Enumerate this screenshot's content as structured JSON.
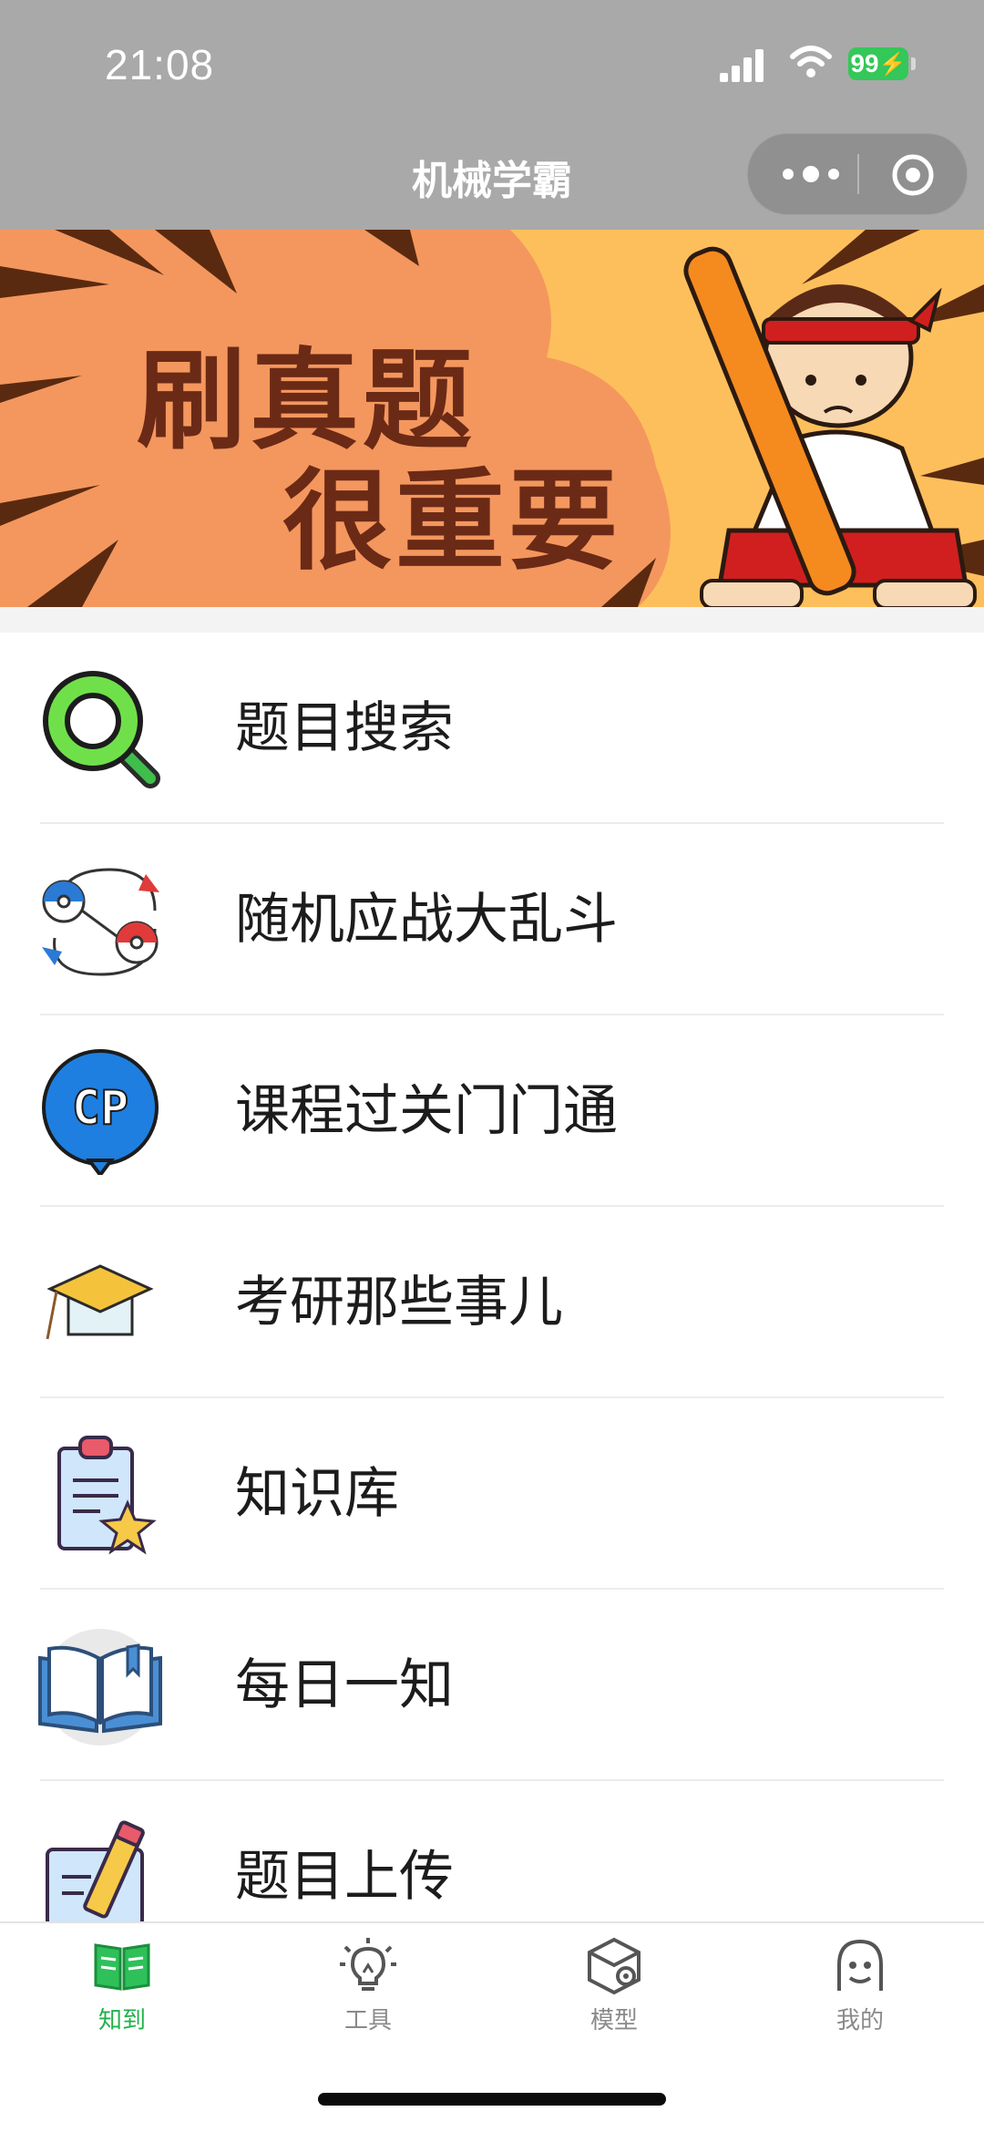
{
  "status_bar": {
    "time": "21:08",
    "battery": "99"
  },
  "nav": {
    "title": "机械学霸",
    "more_icon": "more-dots-icon",
    "close_icon": "target-close-icon"
  },
  "banner": {
    "line1": "刷真题",
    "line2": "很重要",
    "slide_count": 4,
    "active_slide": 1,
    "colors": {
      "bg_light": "#fdbf5c",
      "bg_dark": "#f4975e",
      "text": "#6b2a16"
    }
  },
  "menu": {
    "items": [
      {
        "label": "题目搜索",
        "icon": "search-magnifier-icon"
      },
      {
        "label": "随机应战大乱斗",
        "icon": "battle-pokeball-icon"
      },
      {
        "label": "课程过关门门通",
        "icon": "cp-badge-icon"
      },
      {
        "label": "考研那些事儿",
        "icon": "graduation-cap-icon"
      },
      {
        "label": "知识库",
        "icon": "clipboard-star-icon"
      },
      {
        "label": "每日一知",
        "icon": "open-book-icon"
      },
      {
        "label": "题目上传",
        "icon": "pencil-upload-icon"
      }
    ]
  },
  "tabbar": {
    "tabs": [
      {
        "label": "知到",
        "icon": "book-icon",
        "active": true
      },
      {
        "label": "工具",
        "icon": "lightbulb-icon",
        "active": false
      },
      {
        "label": "模型",
        "icon": "cube-gear-icon",
        "active": false
      },
      {
        "label": "我的",
        "icon": "profile-face-icon",
        "active": false
      }
    ],
    "active_color": "#20b14a"
  }
}
